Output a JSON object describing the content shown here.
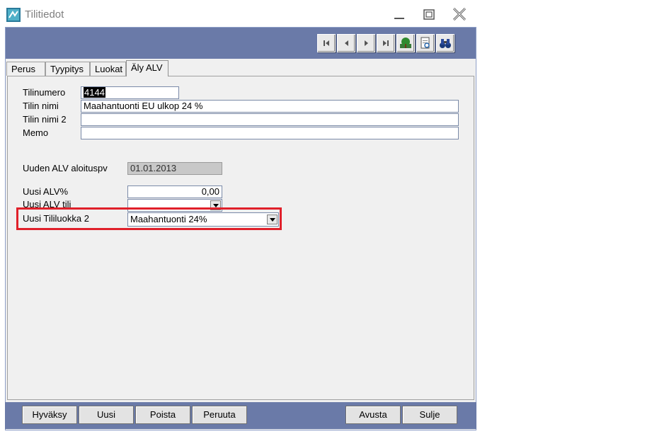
{
  "window": {
    "title": "Tilitiedot"
  },
  "tabs": [
    {
      "label": "Perus",
      "active": false
    },
    {
      "label": "Tyypitys",
      "active": false
    },
    {
      "label": "Luokat",
      "active": false
    },
    {
      "label": "Äly ALV",
      "active": true
    }
  ],
  "form": {
    "tilinumero": {
      "label": "Tilinumero",
      "value": "4144"
    },
    "tilin_nimi": {
      "label": "Tilin nimi",
      "value": "Maahantuonti EU ulkop 24 %"
    },
    "tilin_nimi2": {
      "label": "Tilin nimi 2",
      "value": ""
    },
    "memo": {
      "label": "Memo",
      "value": ""
    },
    "alv_aloituspv": {
      "label": "Uuden ALV aloituspv",
      "value": "01.01.2013"
    },
    "uusi_alv_pct": {
      "label": "Uusi ALV%",
      "value": "0,00"
    },
    "uusi_alv_tili": {
      "label": "Uusi ALV tili",
      "value": ""
    },
    "uusi_tililuokka2": {
      "label": "Uusi Tililuokka 2",
      "value": "Maahantuonti 24%"
    }
  },
  "buttons": {
    "hyvaksy": "Hyväksy",
    "uusi": "Uusi",
    "poista": "Poista",
    "peruuta": "Peruuta",
    "avusta": "Avusta",
    "sulje": "Sulje"
  },
  "colors": {
    "bar": "#6a7aa8",
    "highlight": "#e0202a"
  }
}
